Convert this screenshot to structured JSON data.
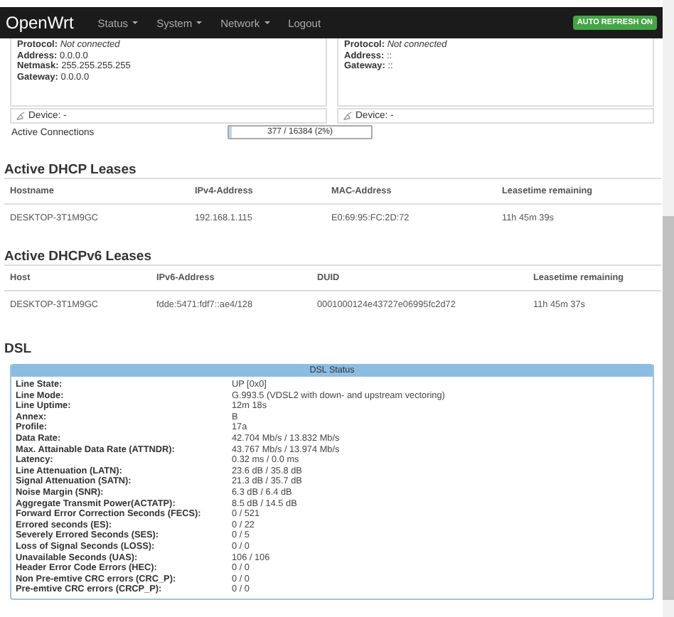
{
  "navbar": {
    "brand": "OpenWrt",
    "menu": [
      {
        "label": "Status",
        "dropdown": true
      },
      {
        "label": "System",
        "dropdown": true
      },
      {
        "label": "Network",
        "dropdown": true
      },
      {
        "label": "Logout",
        "dropdown": false
      }
    ],
    "badge": "AUTO REFRESH ON"
  },
  "interfaces": [
    {
      "fields": [
        {
          "label": "Protocol:",
          "value": "Not connected",
          "italic": true
        },
        {
          "label": "Address:",
          "value": "0.0.0.0",
          "italic": false
        },
        {
          "label": "Netmask:",
          "value": "255.255.255.255",
          "italic": false
        },
        {
          "label": "Gateway:",
          "value": "0.0.0.0",
          "italic": false
        }
      ],
      "device": "Device: -"
    },
    {
      "fields": [
        {
          "label": "Protocol:",
          "value": "Not connected",
          "italic": true
        },
        {
          "label": "Address:",
          "value": "::",
          "italic": false
        },
        {
          "label": "Gateway:",
          "value": "::",
          "italic": false
        }
      ],
      "device": "Device: -"
    }
  ],
  "connections": {
    "label": "Active Connections",
    "reading": "377 / 16384 (2%)",
    "level": 0.023
  },
  "dhcp": {
    "title": "Active DHCP Leases",
    "columns": [
      "Hostname",
      "IPv4-Address",
      "MAC-Address",
      "Leasetime remaining"
    ],
    "rows": [
      [
        "DESKTOP-3T1M9GC",
        "192.168.1.115",
        "E0:69:95:FC:2D:72",
        "11h 45m 39s"
      ]
    ]
  },
  "dhcp6": {
    "title": "Active DHCPv6 Leases",
    "columns": [
      "Host",
      "IPv6-Address",
      "DUID",
      "Leasetime remaining"
    ],
    "rows": [
      [
        "DESKTOP-3T1M9GC",
        "fdde:5471:fdf7::ae4/128",
        "0001000124e43727e06995fc2d72",
        "11h 45m 37s"
      ]
    ]
  },
  "dsl": {
    "title": "DSL",
    "table_title": "DSL Status",
    "rows": [
      {
        "label": "Line State:",
        "value": "UP [0x0]"
      },
      {
        "label": "Line Mode:",
        "value": "G.993.5 (VDSL2 with down- and upstream vectoring)"
      },
      {
        "label": "Line Uptime:",
        "value": "12m 18s"
      },
      {
        "label": "Annex:",
        "value": "B"
      },
      {
        "label": "Profile:",
        "value": "17a"
      },
      {
        "label": "Data Rate:",
        "value": "42.704 Mb/s / 13.832 Mb/s"
      },
      {
        "label": "Max. Attainable Data Rate (ATTNDR):",
        "value": "43.767 Mb/s / 13.974 Mb/s"
      },
      {
        "label": "Latency:",
        "value": "0.32 ms / 0.0 ms"
      },
      {
        "label": "Line Attenuation (LATN):",
        "value": "23.6 dB / 35.8 dB"
      },
      {
        "label": "Signal Attenuation (SATN):",
        "value": "21.3 dB / 35.7 dB"
      },
      {
        "label": "Noise Margin (SNR):",
        "value": "6.3 dB / 6.4 dB"
      },
      {
        "label": "Aggregate Transmit Power(ACTATP):",
        "value": "8.5 dB / 14.5 dB"
      },
      {
        "label": "Forward Error Correction Seconds (FECS):",
        "value": "0 / 521"
      },
      {
        "label": "Errored seconds (ES):",
        "value": "0 / 22"
      },
      {
        "label": "Severely Errored Seconds (SES):",
        "value": "0 / 5"
      },
      {
        "label": "Loss of Signal Seconds (LOSS):",
        "value": "0 / 0"
      },
      {
        "label": "Unavailable Seconds (UAS):",
        "value": "106 / 106"
      },
      {
        "label": "Header Error Code Errors (HEC):",
        "value": "0 / 0"
      },
      {
        "label": "Non Pre-emtive CRC errors (CRC_P):",
        "value": "0 / 0"
      },
      {
        "label": "Pre-emtive CRC errors (CRCP_P):",
        "value": "0 / 0"
      }
    ]
  }
}
